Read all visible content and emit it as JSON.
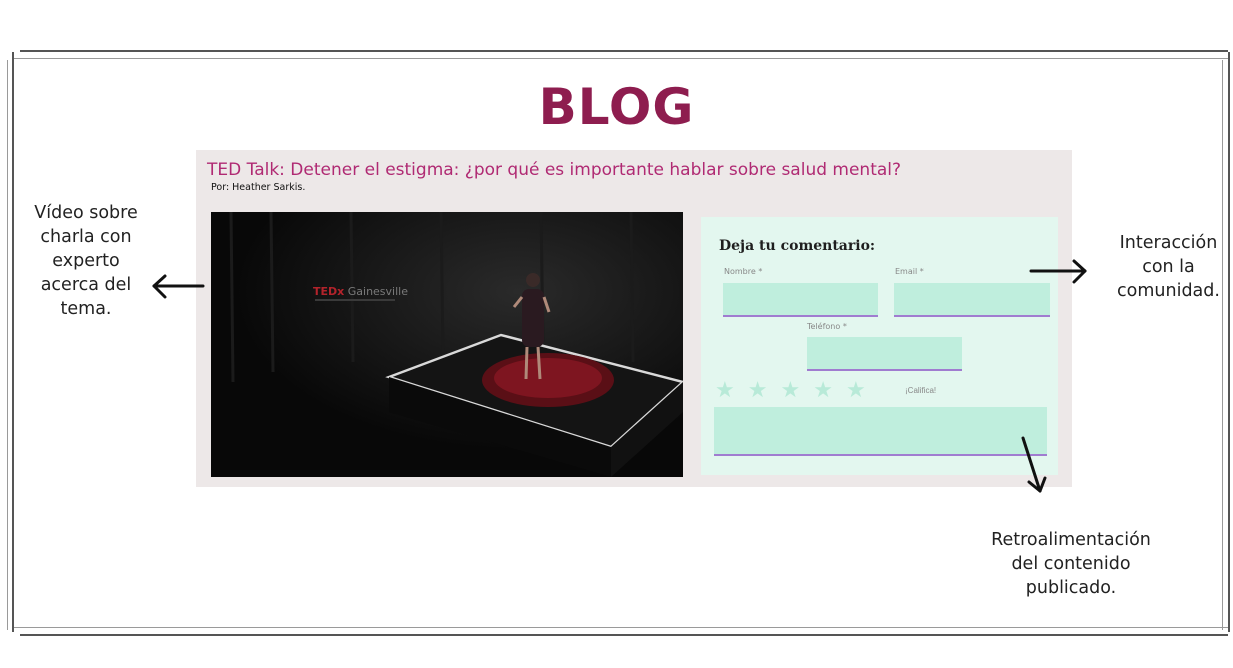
{
  "blog": {
    "title": "BLOG"
  },
  "post": {
    "title": "TED Talk: Detener el estigma: ¿por qué es importante hablar sobre salud mental?",
    "author": "Por: Heather Sarkis."
  },
  "video": {
    "logo_ted": "TEDx",
    "logo_city": "Gainesville"
  },
  "comment_form": {
    "heading": "Deja tu comentario:",
    "name_label": "Nombre *",
    "email_label": "Email *",
    "phone_label": "Teléfono *",
    "rating_label": "¡Califica!",
    "stars": 5
  },
  "annotations": {
    "video_note": [
      "Vídeo sobre",
      "charla con",
      "experto",
      "acerca del",
      "tema."
    ],
    "community_note": [
      "Interacción",
      "con la",
      "comunidad."
    ],
    "feedback_note": [
      "Retroalimentación",
      "del contenido",
      "publicado."
    ]
  },
  "colors": {
    "title": "#8e1d4f",
    "post_title": "#b02a73",
    "form_bg": "#e3f7ef",
    "input_bg": "#bfeedd",
    "star": "#b8ead8",
    "input_underline": "#a07cd0"
  }
}
